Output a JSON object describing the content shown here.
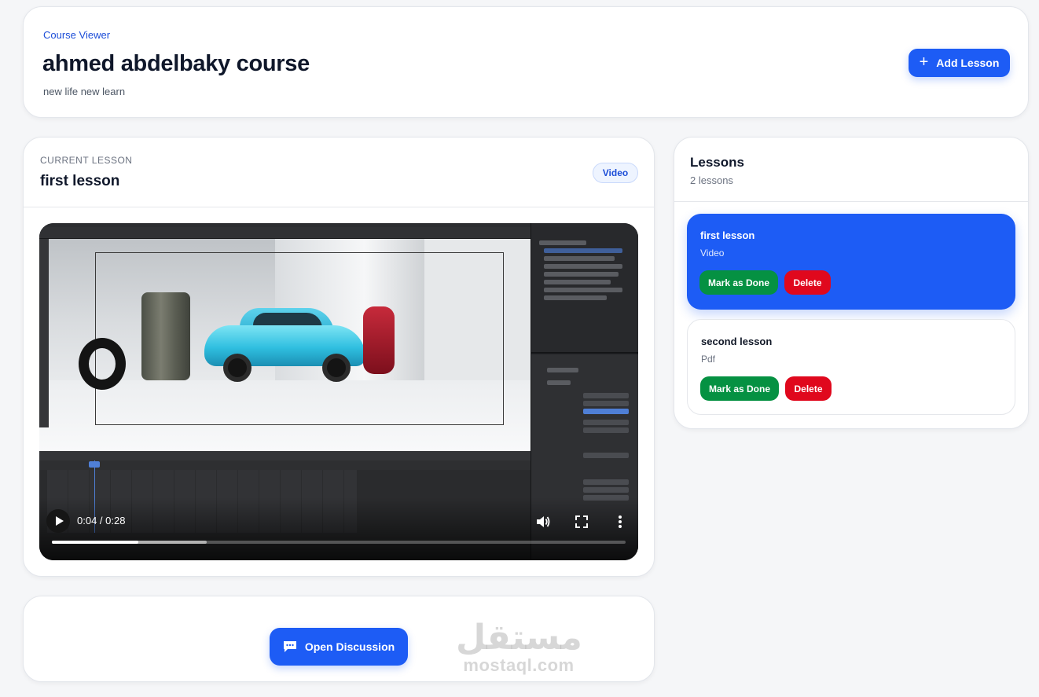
{
  "header": {
    "breadcrumb": "Course Viewer",
    "title": "ahmed abdelbaky course",
    "subtitle": "new life new learn",
    "add_lesson_label": "Add Lesson"
  },
  "current_lesson": {
    "label": "CURRENT LESSON",
    "title": "first lesson",
    "type_badge": "Video"
  },
  "video": {
    "time_display": "0:04 / 0:28",
    "progress": 0.15,
    "buffered": 0.27
  },
  "discussion": {
    "button_label": "Open Discussion"
  },
  "lessons_panel": {
    "title": "Lessons",
    "count_text": "2 lessons",
    "items": [
      {
        "title": "first lesson",
        "type": "Video",
        "done_label": "Mark as Done",
        "delete_label": "Delete",
        "active": true
      },
      {
        "title": "second lesson",
        "type": "Pdf",
        "done_label": "Mark as Done",
        "delete_label": "Delete",
        "active": false
      }
    ]
  },
  "watermark": {
    "arabic": "مستقل",
    "latin": "mostaql.com"
  },
  "colors": {
    "accent": "#1d5cf5",
    "success": "#059142",
    "danger": "#e0081d",
    "background": "#f5f6f8"
  },
  "icons": [
    "plus-icon",
    "play-icon",
    "volume-icon",
    "fullscreen-icon",
    "more-vert-icon",
    "chat-icon"
  ]
}
